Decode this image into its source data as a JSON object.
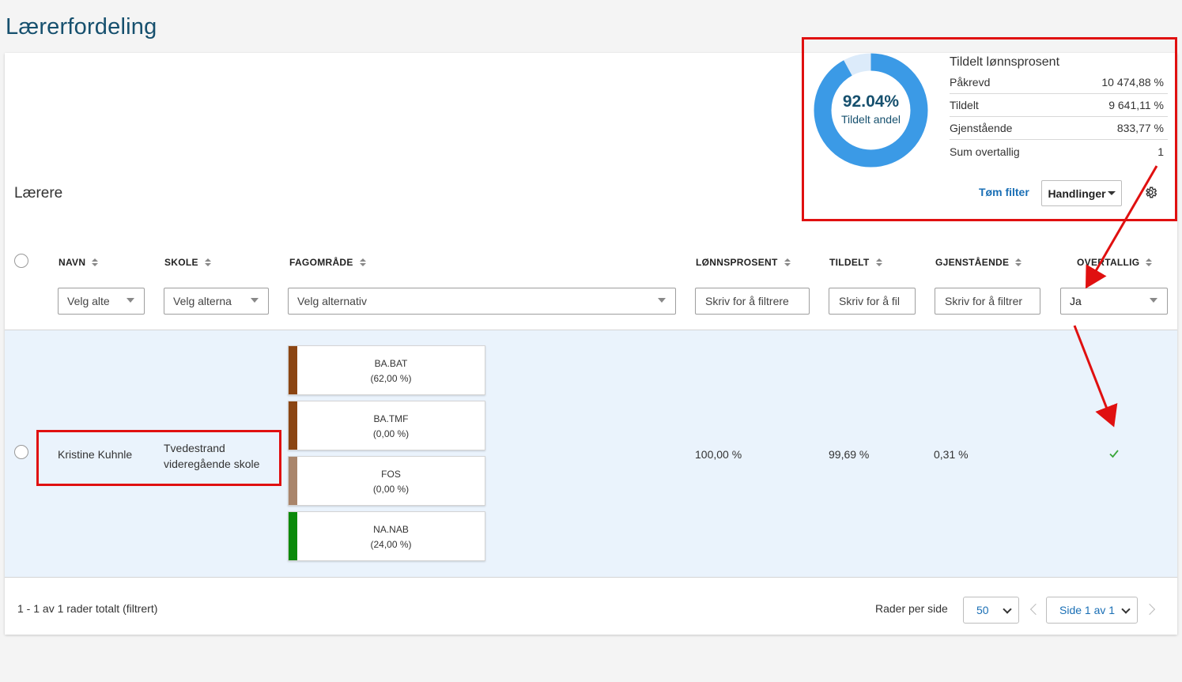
{
  "page": {
    "title": "Lærerfordeling"
  },
  "summary": {
    "percent": "92.04%",
    "percent_label": "Tildelt andel",
    "fill_fraction": 0.9204,
    "title": "Tildelt lønnsprosent",
    "rows": [
      {
        "label": "Påkrevd",
        "value": "10 474,88 %"
      },
      {
        "label": "Tildelt",
        "value": "9 641,11 %"
      },
      {
        "label": "Gjenstående",
        "value": "833,77 %"
      },
      {
        "label": "Sum overtallig",
        "value": "1"
      }
    ],
    "colors": {
      "fill": "#3b9ae6",
      "track": "#dcebfa"
    }
  },
  "section": {
    "title": "Lærere",
    "clear_filter": "Tøm filter",
    "actions": "Handlinger",
    "settings_icon": "gear-icon"
  },
  "table": {
    "columns": [
      {
        "key": "navn",
        "label": "NAVN"
      },
      {
        "key": "skole",
        "label": "SKOLE"
      },
      {
        "key": "fagomrade",
        "label": "FAGOMRÅDE"
      },
      {
        "key": "lonnsprosent",
        "label": "LØNNSPROSENT"
      },
      {
        "key": "tildelt",
        "label": "TILDELT"
      },
      {
        "key": "gjenstaende",
        "label": "GJENSTÅENDE"
      },
      {
        "key": "overtallig",
        "label": "OVERTALLIG"
      }
    ],
    "filters": {
      "navn": "Velg alte",
      "skole": "Velg alterna",
      "fagomrade": "Velg alternativ",
      "lonnsprosent": "Skriv for å filtrere",
      "tildelt": "Skriv for å fil",
      "gjenstaende": "Skriv for å filtrer",
      "overtallig": "Ja"
    },
    "rows": [
      {
        "navn": "Kristine Kuhnle",
        "skole_line1": "Tvedestrand",
        "skole_line2": "videregående skole",
        "subjects": [
          {
            "code": "BA.BAT",
            "pct": "(62,00 %)",
            "color": "#8b4513"
          },
          {
            "code": "BA.TMF",
            "pct": "(0,00 %)",
            "color": "#8b4513"
          },
          {
            "code": "FOS",
            "pct": "(0,00 %)",
            "color": "#a9856b"
          },
          {
            "code": "NA.NAB",
            "pct": "(24,00 %)",
            "color": "#0a8a0a"
          }
        ],
        "lonnsprosent": "100,00 %",
        "tildelt": "99,69 %",
        "gjenstaende": "0,31 %",
        "overtallig_icon": "checkmark-icon"
      }
    ]
  },
  "footer": {
    "summary": "1 - 1 av 1 rader totalt (filtrert)",
    "rows_per_page_label": "Rader per side",
    "rows_per_page": "50",
    "page_select": "Side 1 av 1"
  },
  "annotation_color": "#e01010"
}
